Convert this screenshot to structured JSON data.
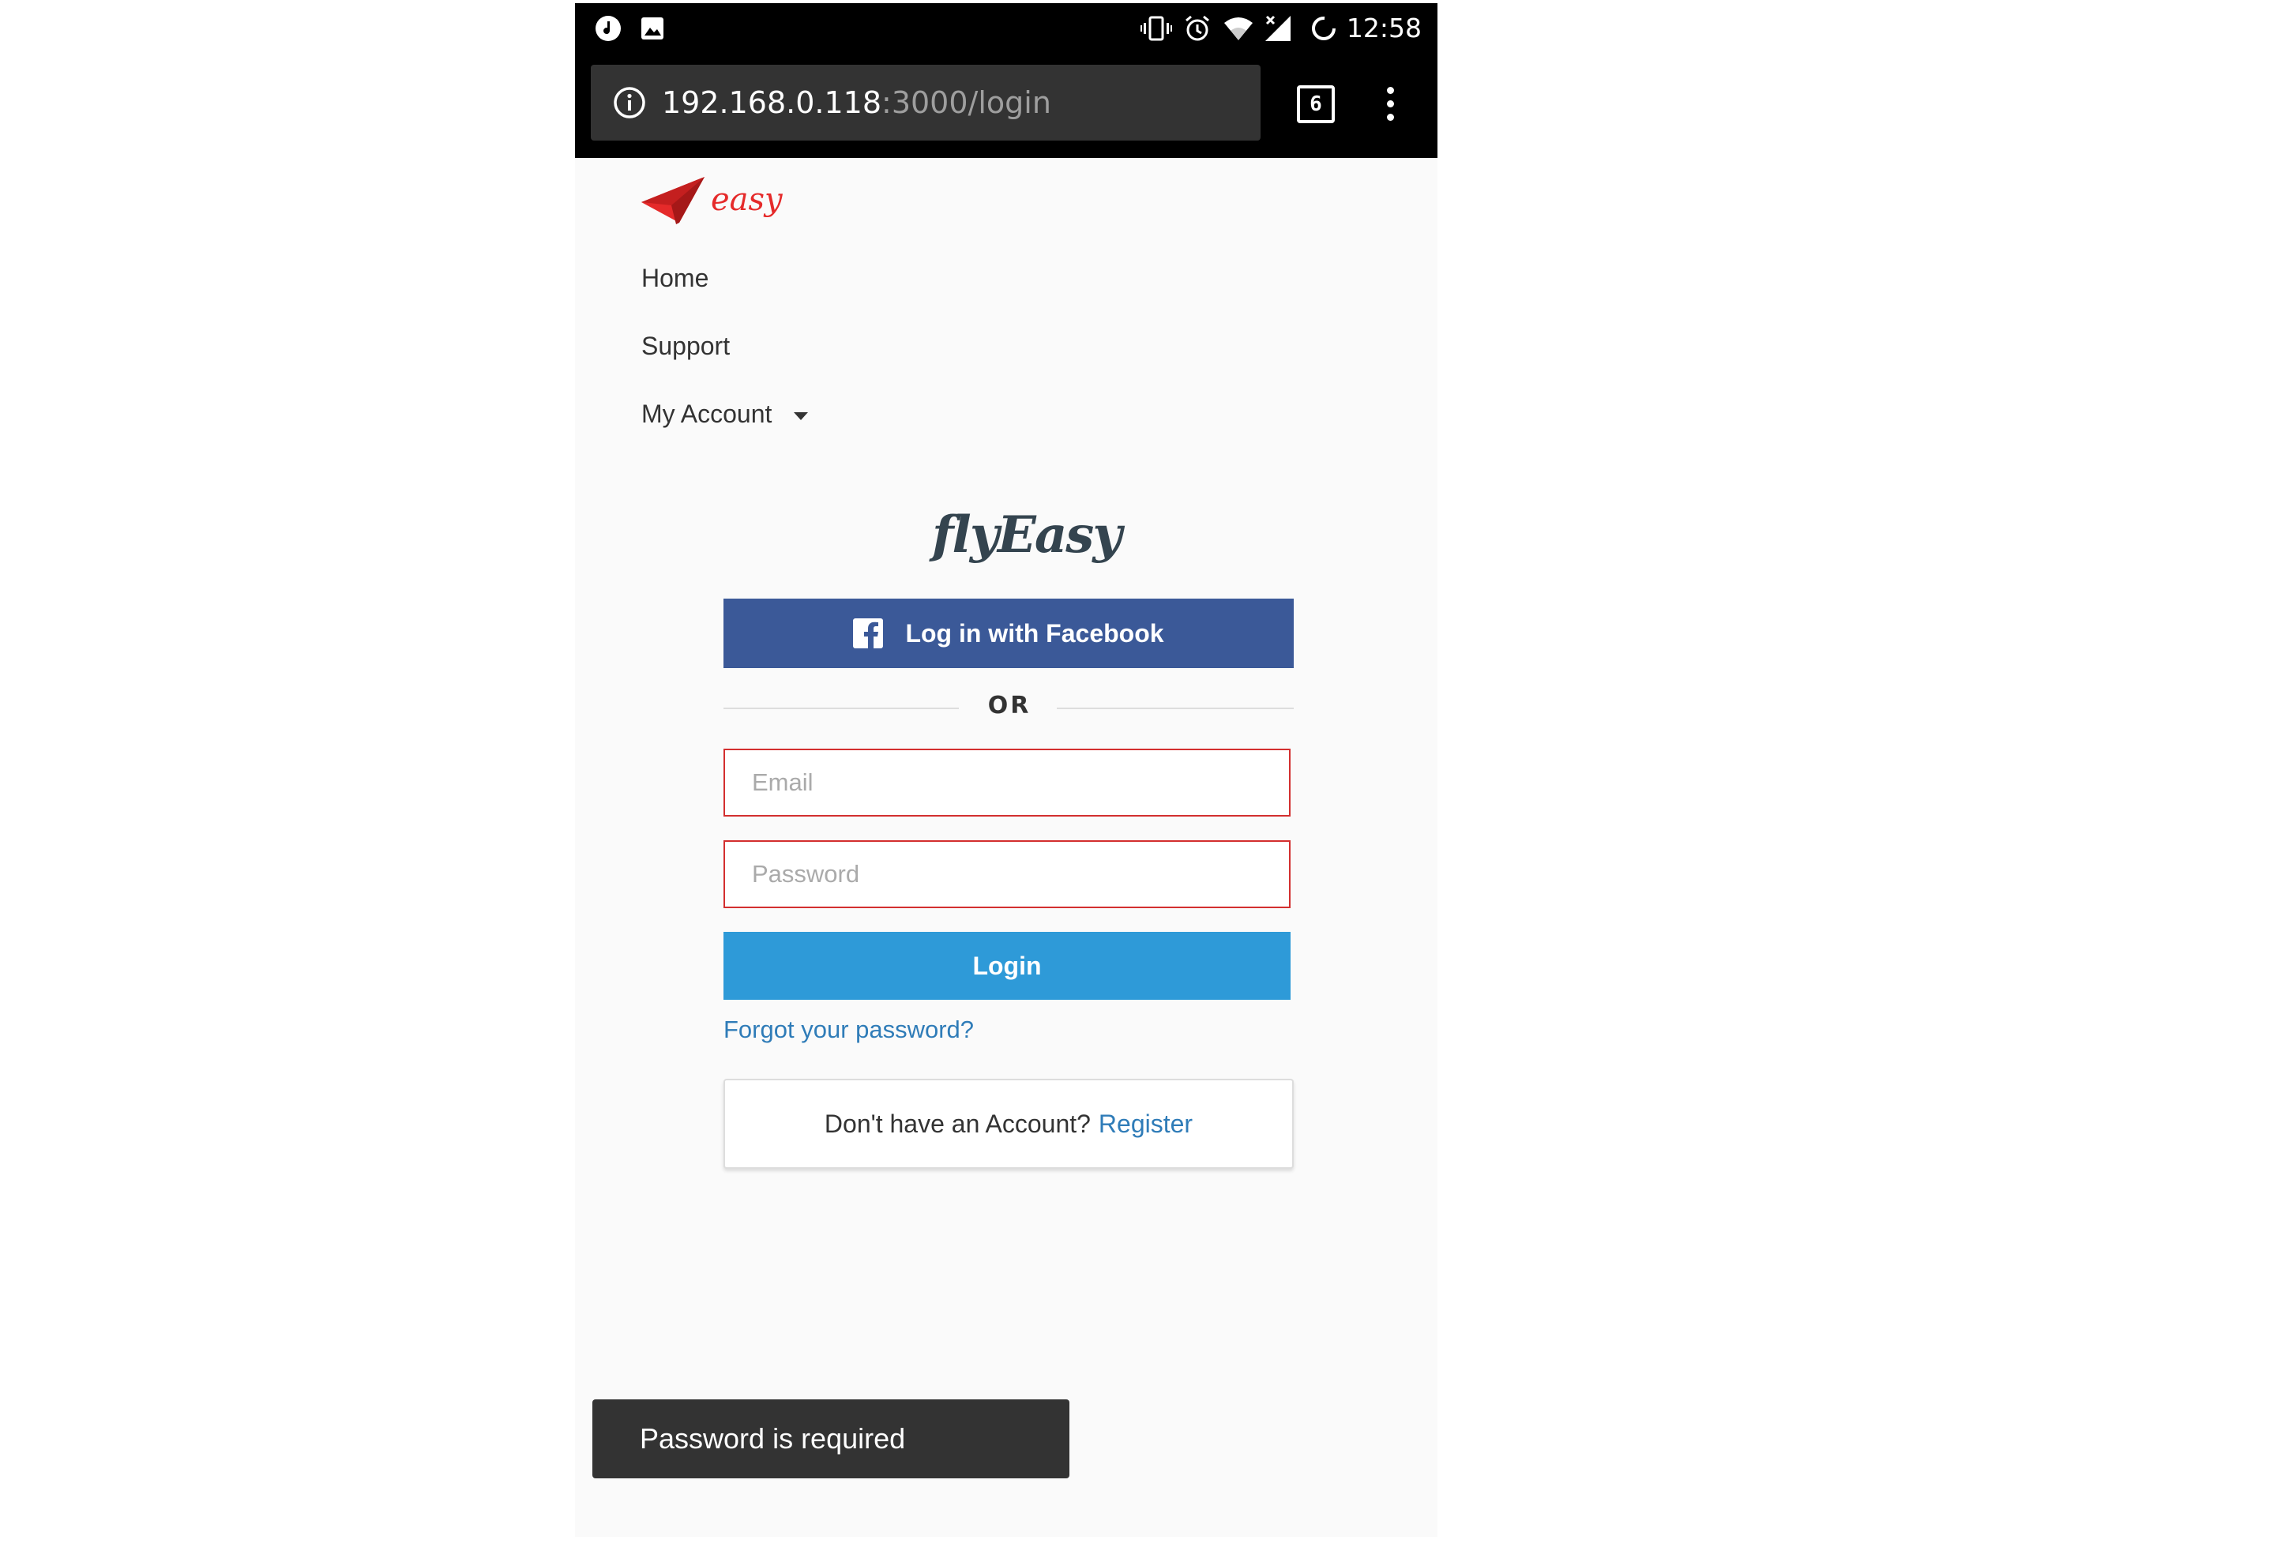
{
  "status_bar": {
    "time": "12:58",
    "left_icons": [
      "music-icon",
      "image-icon"
    ],
    "right_icons": [
      "vibrate-icon",
      "alarm-icon",
      "wifi-icon",
      "no-signal-icon",
      "loading-icon"
    ]
  },
  "url_bar": {
    "host": "192.168.0.118",
    "path": ":3000/login",
    "tab_count": "6"
  },
  "nav": {
    "logo_text": "easy",
    "items": [
      {
        "label": "Home"
      },
      {
        "label": "Support"
      },
      {
        "label": "My Account"
      }
    ]
  },
  "login": {
    "brand": "flyEasy",
    "facebook_label": "Log in with Facebook",
    "or_label": "OR",
    "email_placeholder": "Email",
    "password_placeholder": "Password",
    "login_label": "Login",
    "forgot_label": "Forgot your password?",
    "register_prompt": "Don't have an Account?",
    "register_link": "Register"
  },
  "toast": {
    "message": "Password is required"
  },
  "colors": {
    "facebook": "#3b5998",
    "login_button": "#2e9ad8",
    "error_border": "#d32f2f",
    "link": "#2f7cb8",
    "logo_red": "#e52a2a"
  }
}
